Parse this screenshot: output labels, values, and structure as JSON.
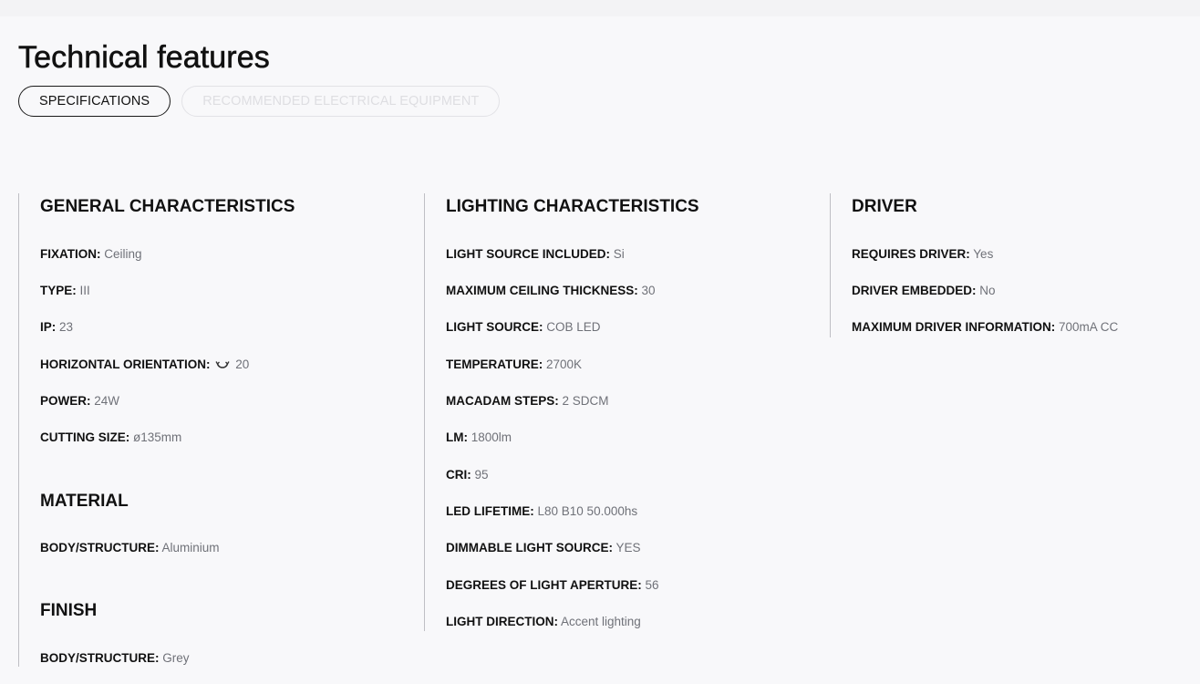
{
  "page": {
    "title": "Technical features"
  },
  "tabs": [
    {
      "label": "SPECIFICATIONS",
      "active": true
    },
    {
      "label": "RECOMMENDED ELECTRICAL EQUIPMENT",
      "active": false
    }
  ],
  "general": {
    "title": "GENERAL CHARACTERISTICS",
    "rows": [
      {
        "key": "FIXATION:",
        "value": "Ceiling"
      },
      {
        "key": "TYPE:",
        "value": "III"
      },
      {
        "key": "IP:",
        "value": "23"
      },
      {
        "key": "HORIZONTAL ORIENTATION:",
        "value": "20",
        "icon": "rotation-icon"
      },
      {
        "key": "POWER:",
        "value": "24W"
      },
      {
        "key": "CUTTING SIZE:",
        "value": "ø135mm"
      }
    ]
  },
  "material": {
    "title": "MATERIAL",
    "rows": [
      {
        "key": "BODY/STRUCTURE:",
        "value": "Aluminium"
      }
    ]
  },
  "finish": {
    "title": "FINISH",
    "rows": [
      {
        "key": "BODY/STRUCTURE:",
        "value": "Grey"
      }
    ]
  },
  "lighting": {
    "title": "LIGHTING CHARACTERISTICS",
    "rows": [
      {
        "key": "LIGHT SOURCE INCLUDED:",
        "value": "Si"
      },
      {
        "key": "MAXIMUM CEILING THICKNESS:",
        "value": "30"
      },
      {
        "key": "LIGHT SOURCE:",
        "value": "COB LED"
      },
      {
        "key": "TEMPERATURE:",
        "value": "2700K"
      },
      {
        "key": "MACADAM STEPS:",
        "value": "2 SDCM"
      },
      {
        "key": "LM:",
        "value": "1800lm"
      },
      {
        "key": "CRI:",
        "value": "95"
      },
      {
        "key": "LED LIFETIME:",
        "value": "L80 B10 50.000hs"
      },
      {
        "key": "DIMMABLE LIGHT SOURCE:",
        "value": "YES"
      },
      {
        "key": "DEGREES OF LIGHT APERTURE:",
        "value": "56"
      },
      {
        "key": "LIGHT DIRECTION:",
        "value": "Accent lighting"
      }
    ]
  },
  "driver": {
    "title": "DRIVER",
    "rows": [
      {
        "key": "REQUIRES DRIVER:",
        "value": "Yes"
      },
      {
        "key": "DRIVER EMBEDDED:",
        "value": "No"
      },
      {
        "key": "MAXIMUM DRIVER INFORMATION:",
        "value": "700mA CC"
      }
    ]
  }
}
